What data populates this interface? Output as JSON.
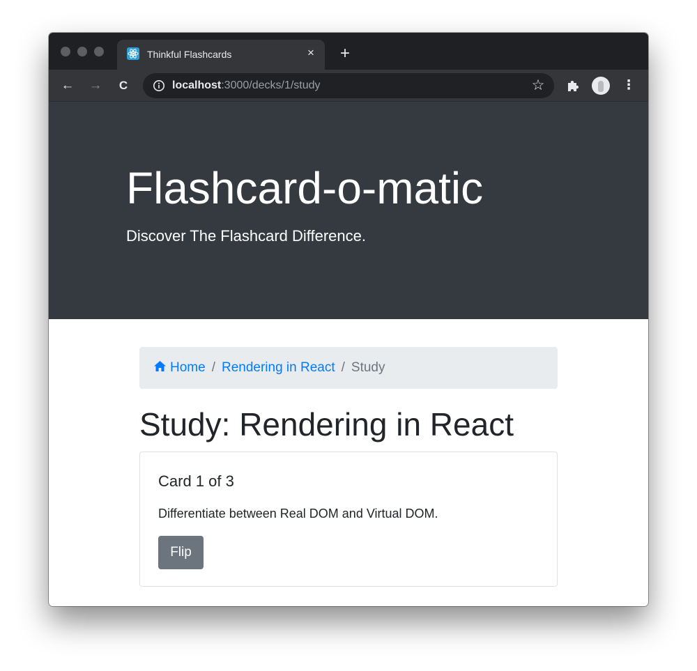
{
  "browser": {
    "tab_title": "Thinkful Flashcards",
    "tab_close_icon": "×",
    "new_tab_icon": "+",
    "back_icon": "←",
    "forward_icon": "→",
    "reload_icon": "C",
    "url_host": "localhost",
    "url_path": ":3000/decks/1/study",
    "bookmark_icon": "☆",
    "menu_icon": "⋮",
    "colors": {
      "tabstrip": "#1f2023",
      "toolbar": "#35363a",
      "omnibox": "#202124",
      "favicon": "#2d9fd4"
    },
    "icons": [
      "react-favicon-icon",
      "info-icon",
      "star-icon",
      "extensions-puzzle-icon",
      "profile-avatar-icon",
      "kebab-menu-icon"
    ]
  },
  "header": {
    "title": "Flashcard-o-matic",
    "subtitle": "Discover The Flashcard Difference.",
    "background_color": "#343a40"
  },
  "breadcrumb": {
    "home_label": "Home",
    "deck_label": "Rendering in React",
    "current_label": "Study",
    "separator": "/",
    "link_color": "#007bff"
  },
  "study": {
    "heading": "Study: Rendering in React",
    "card": {
      "title": "Card 1 of 3",
      "text": "Differentiate between Real DOM and Virtual DOM.",
      "flip_label": "Flip",
      "button_color": "#6c757d"
    }
  }
}
